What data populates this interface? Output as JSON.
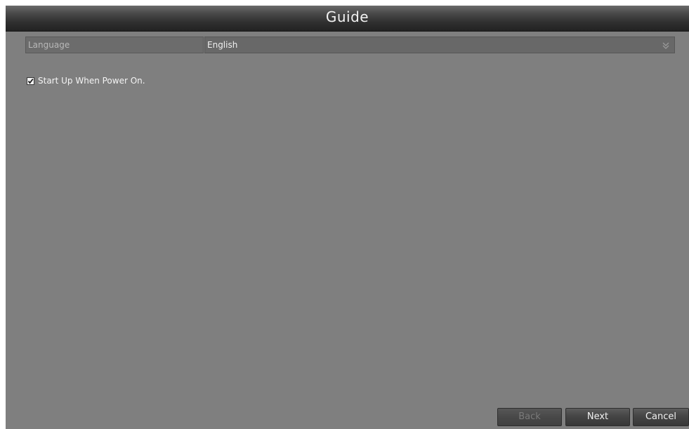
{
  "window": {
    "title": "Guide"
  },
  "language": {
    "label": "Language",
    "value": "English",
    "icon": "chevron-down-icon"
  },
  "startup": {
    "label": "Start Up When Power On.",
    "checked": true
  },
  "buttons": {
    "back": "Back",
    "next": "Next",
    "cancel": "Cancel"
  },
  "colors": {
    "background": "#7f7f7f",
    "titlebar": "#303030",
    "text": "#f2f2f2"
  }
}
